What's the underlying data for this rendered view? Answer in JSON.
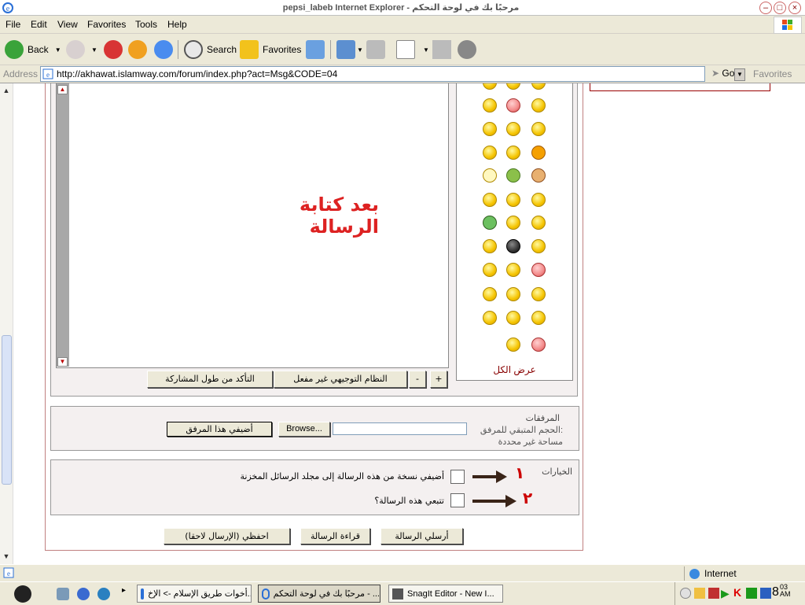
{
  "window": {
    "title": "pepsi_labeb Internet Explorer - مرحبًا بك في لوحة التحكم",
    "controls": {
      "minimize": "–",
      "maximize": "□",
      "close": "×"
    }
  },
  "menu": [
    "File",
    "Edit",
    "View",
    "Favorites",
    "Tools",
    "Help"
  ],
  "toolbar": {
    "back": "Back",
    "search": "Search",
    "favorites": "Favorites"
  },
  "address": {
    "label": "Address",
    "url": "http://akhawat.islamway.com/forum/index.php?act=Msg&CODE=04",
    "go": "Go",
    "favorites": "Favorites"
  },
  "editor": {
    "body_text": "بعد كتابة الرسالة",
    "plus": "+",
    "minus": "-",
    "guided_mode": "النظام التوجيهي غير مفعل",
    "check_length": "التأكد من طول المشاركة",
    "show_all": "عرض الكل"
  },
  "attachments": {
    "title": "المرفقات",
    "remaining": "الحجم المتبقي للمرفق:",
    "space": "مساحة غير محددة",
    "browse": "Browse...",
    "add": "أضيفي هذا المرفق"
  },
  "options": {
    "title": "الخيارات",
    "save_copy": "أضيفي نسخة من هذه الرسالة إلى مجلد الرسائل المخزنة",
    "track": "تتبعي هذه الرسالة؟",
    "marker1": "١",
    "marker2": "٢"
  },
  "actions": {
    "send": "أرسلي الرسالة",
    "preview": "قراءة الرسالة",
    "save_later": "احفظي (الإرسال لاحقا)"
  },
  "status": {
    "zone": "Internet"
  },
  "taskbar": {
    "tasks": [
      {
        "label": "أخوات طريق الإسلام -> الإخ..."
      },
      {
        "label": "مرحبًا بك في لوحة التحكم - ..."
      },
      {
        "label": "SnagIt Editor - New I..."
      }
    ],
    "clock_hour": "8",
    "clock_minutes": "03",
    "clock_ampm": "AM"
  }
}
